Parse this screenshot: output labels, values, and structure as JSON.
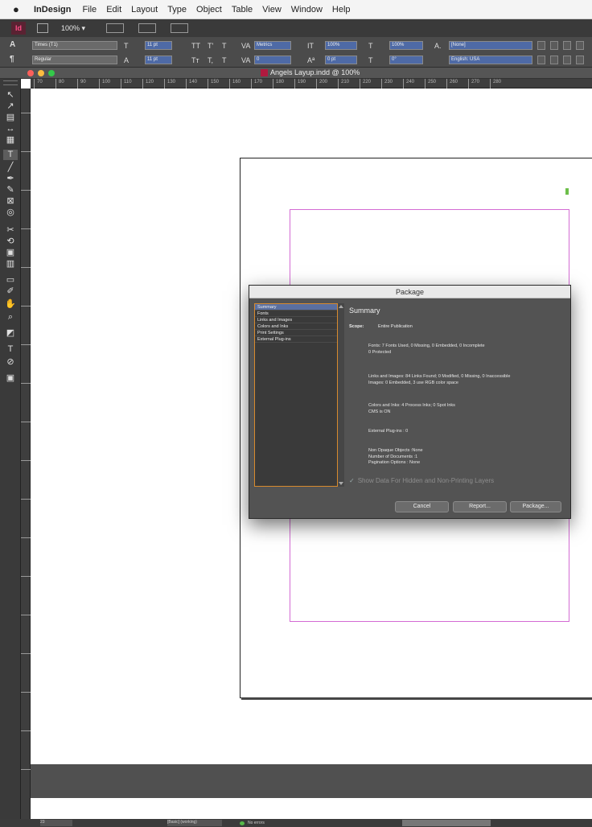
{
  "menubar": {
    "app": "InDesign",
    "items": [
      "File",
      "Edit",
      "Layout",
      "Type",
      "Object",
      "Table",
      "View",
      "Window",
      "Help"
    ]
  },
  "appbar": {
    "logo": "Id",
    "zoom": "100% ▾"
  },
  "control_panel": {
    "font_family": "Times (T1)",
    "font_style": "Regular",
    "font_size": "11 pt",
    "leading": "11 pt",
    "kerning": "Metrics",
    "tracking": "0",
    "vscale": "100%",
    "hscale": "100%",
    "baseline": "0 pt",
    "skew": "0°",
    "char_style": "[None]",
    "language": "English: USA"
  },
  "document": {
    "title": "Angels Layup.indd @ 100%"
  },
  "ruler": {
    "labels": [
      "70",
      "80",
      "90",
      "100",
      "110",
      "120",
      "130",
      "140",
      "150",
      "160",
      "170",
      "180",
      "190",
      "200",
      "210",
      "220",
      "230",
      "240",
      "250",
      "260",
      "270",
      "280"
    ]
  },
  "dialog": {
    "title": "Package",
    "categories": [
      "Summary",
      "Fonts",
      "Links and Images",
      "Colors and Inks",
      "Print Settings",
      "External Plug-ins"
    ],
    "selected_category": 0,
    "heading": "Summary",
    "scope_label": "Scope:",
    "scope_value": "Entire Publication",
    "fonts_line1": "Fonts: 7 Fonts Used, 0 Missing, 0 Embedded, 0 Incomplete",
    "fonts_line2": "0 Protected",
    "links_line1": "Links and Images: 84 Links Found; 0 Modified, 0 Missing, 0 Inaccessible",
    "links_line2": "Images: 0 Embedded, 3 use RGB color space",
    "colors_line1": "Colors and Inks: 4 Process Inks; 0 Spot Inks",
    "colors_line2": "CMS is ON",
    "plugins_line": "External Plug-ins : 0",
    "nonopaque_line": "Non Opaque Objects :None",
    "numdocs_line": "Number of Documents :1",
    "pagination_line": "Pagination Options : None",
    "show_hidden_label": "Show Data For Hidden and Non-Printing Layers",
    "buttons": {
      "cancel": "Cancel",
      "report": "Report...",
      "package": "Package..."
    }
  },
  "statusbar": {
    "page": "23",
    "profile": "[Basic] (working)",
    "errors": "No errors"
  },
  "colors": {
    "accent_orange": "#d88a2e",
    "selection_blue": "#5a6fa0",
    "margin_magenta": "#d46bd4",
    "indesign_pink": "#ff4d86"
  }
}
